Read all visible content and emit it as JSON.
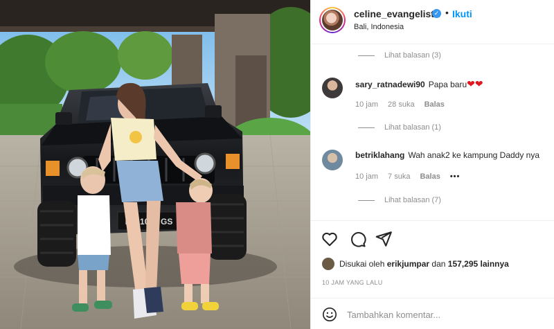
{
  "post": {
    "photo_icon": "photo-of-family-with-hummer",
    "plate_text": "BG 1000 GS"
  },
  "header": {
    "username": "celine_evangelista",
    "verified_icon": "verified-badge-icon",
    "separator": "•",
    "follow_label": "Ikuti",
    "location": "Bali, Indonesia"
  },
  "comments": {
    "replies_1": "Lihat balasan (3)",
    "items": [
      {
        "username": "sary_ratnadewi90",
        "text": "Papa baru",
        "emoji": "❤❤",
        "time": "10 jam",
        "likes": "28 suka",
        "reply": "Balas",
        "replies": "Lihat balasan (1)"
      },
      {
        "username": "betriklahang",
        "text": "Wah anak2 ke kampung Daddy nya",
        "time": "10 jam",
        "likes": "7 suka",
        "reply": "Balas",
        "more": "•••",
        "replies": "Lihat balasan (7)"
      }
    ]
  },
  "actions": {
    "like_icon": "heart-icon",
    "comment_icon": "comment-bubble-icon",
    "share_icon": "paper-plane-icon"
  },
  "likes": {
    "prefix": "Disukai oleh",
    "user": "erikjumpar",
    "middle": "dan",
    "count": "157,295 lainnya"
  },
  "timestamp": "10 JAM YANG LALU",
  "add_comment": {
    "emoji_icon": "smiley-icon",
    "placeholder": "Tambahkan komentar..."
  },
  "colors": {
    "link_blue": "#0095f6",
    "verified_blue": "#3897f0",
    "heart_red": "#e0171f",
    "muted": "#8e8e8e"
  }
}
